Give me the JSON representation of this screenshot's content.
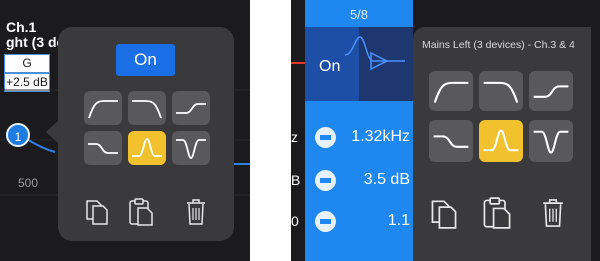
{
  "left_panel": {
    "channel_title_line1": "Ch.1",
    "channel_title_line2": "ght (3 de",
    "band_label": "G",
    "gain_value": "+2.5 dB",
    "freq_tick": "500",
    "node_number": "1",
    "popover": {
      "on_label": "On",
      "filters": [
        "high-pass",
        "low-pass",
        "high-shelf",
        "low-shelf",
        "peak",
        "notch"
      ],
      "selected_filter": "peak",
      "actions": [
        "copy-icon",
        "paste-icon",
        "trash-icon"
      ]
    }
  },
  "right_panel": {
    "page_indicator": "5/8",
    "on_label": "On",
    "edge_letters": [
      "z",
      "B",
      "0"
    ],
    "params": {
      "frequency": "1.32kHz",
      "gain": "3.5 dB",
      "q": "1.1"
    },
    "popover": {
      "title": "Mains Left (3 devices) - Ch.3 & 4",
      "filters": [
        "high-pass",
        "low-pass",
        "high-shelf",
        "low-shelf",
        "peak",
        "notch"
      ],
      "selected_filter": "peak",
      "actions": [
        "copy-icon",
        "paste-icon",
        "trash-icon"
      ]
    }
  },
  "colors": {
    "accent_blue": "#1a6fe6",
    "selected_filter": "#f2c12e",
    "popover_bg": "#3a3a3c",
    "filter_button": "#59595c"
  }
}
